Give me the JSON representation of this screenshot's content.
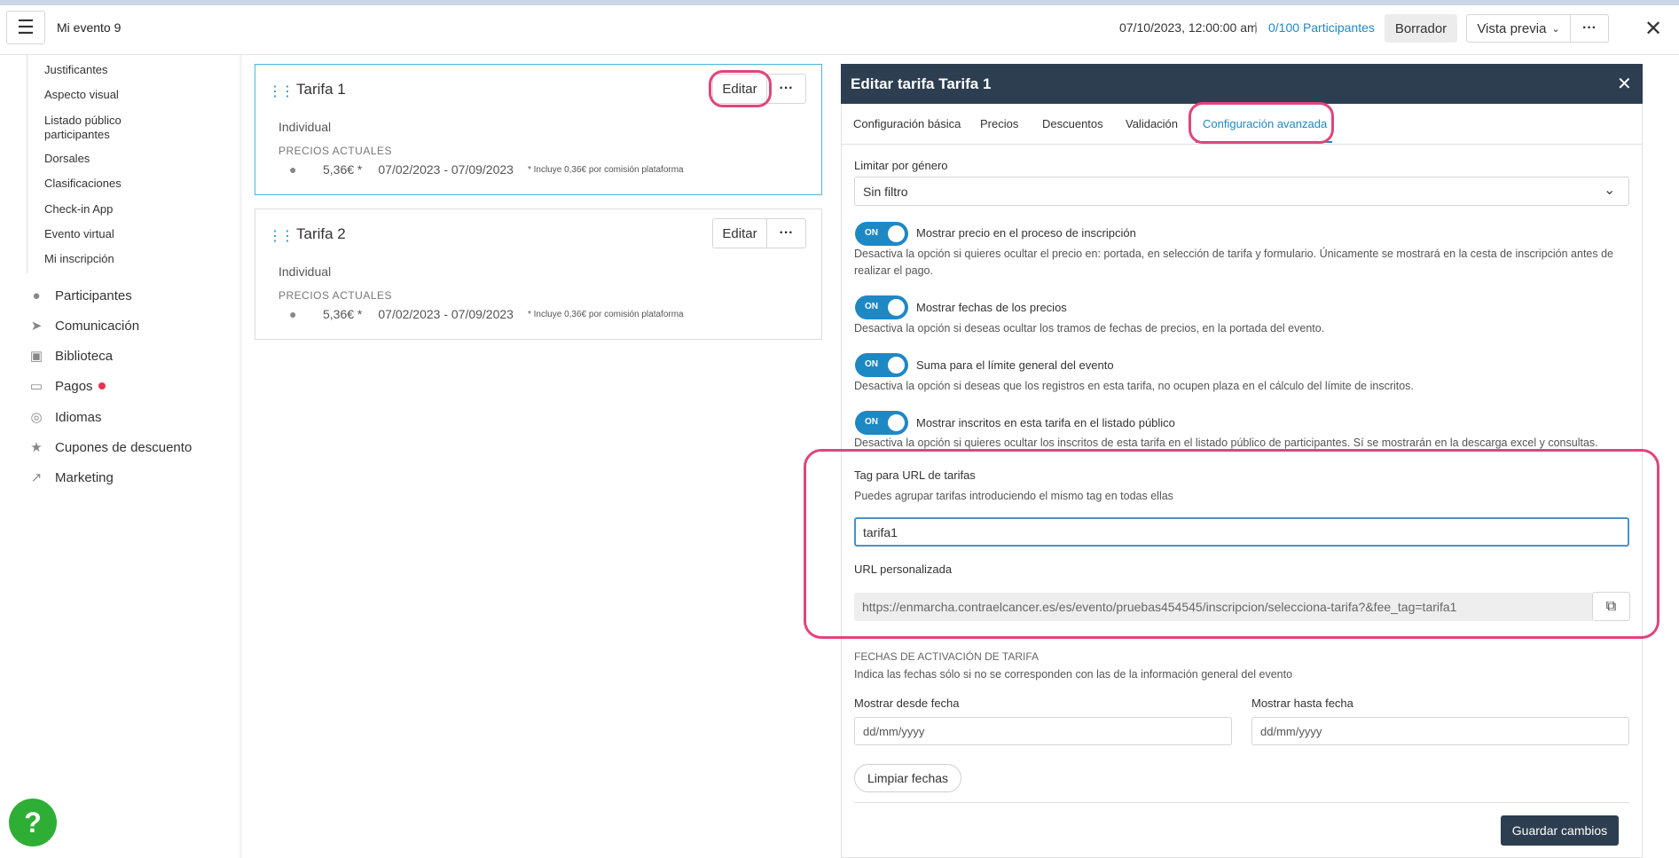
{
  "topbar": {
    "event_name": "Mi evento 9",
    "date": "07/10/2023, 12:00:00 am",
    "separator": "|",
    "participants_count": "0/100",
    "participants_label": "Participantes",
    "draft_label": "Borrador",
    "preview_label": "Vista previa"
  },
  "sidebar": {
    "subitems": [
      "Justificantes",
      "Aspecto visual",
      "Listado público participantes",
      "Dorsales",
      "Clasificaciones",
      "Check-in App",
      "Evento virtual",
      "Mi inscripción"
    ],
    "items": [
      "Participantes",
      "Comunicación",
      "Biblioteca",
      "Pagos",
      "Idiomas",
      "Cupones de descuento",
      "Marketing"
    ],
    "help": "?"
  },
  "cards": [
    {
      "title": "Tarifa 1",
      "edit_label": "Editar",
      "type": "Individual",
      "prices_label": "PRECIOS ACTUALES",
      "price": "5,36€ *",
      "dates": "07/02/2023 - 07/09/2023",
      "note": "* Incluye 0,36€ por comisión plataforma"
    },
    {
      "title": "Tarifa 2",
      "edit_label": "Editar",
      "type": "Individual",
      "prices_label": "PRECIOS ACTUALES",
      "price": "5,36€ *",
      "dates": "07/02/2023 - 07/09/2023",
      "note": "* Incluye 0,36€ por comisión plataforma"
    }
  ],
  "panel": {
    "title": "Editar tarifa Tarifa 1",
    "tabs": [
      "Configuración básica",
      "Precios",
      "Descuentos",
      "Validación",
      "Configuración avanzada"
    ],
    "active_tab": "Configuración avanzada",
    "gender_label": "Limitar por género",
    "gender_value": "Sin filtro",
    "toggles": [
      {
        "state": "ON",
        "label": "Mostrar precio en el proceso de inscripción",
        "desc": "Desactiva la opción si quieres ocultar el precio en: portada, en selección de tarifa y formulario. Únicamente se mostrará en la cesta de inscripción antes de realizar el pago."
      },
      {
        "state": "ON",
        "label": "Mostrar fechas de los precios",
        "desc": "Desactiva la opción si deseas ocultar los tramos de fechas de precios, en la portada del evento."
      },
      {
        "state": "ON",
        "label": "Suma para el límite general del evento",
        "desc": "Desactiva la opción si deseas que los registros en esta tarifa, no ocupen plaza en el cálculo del límite de inscritos."
      },
      {
        "state": "ON",
        "label": "Mostrar inscritos en esta tarifa en el listado público",
        "desc": "Desactiva la opción si quieres ocultar los inscritos de esta tarifa en el listado público de participantes. Sí se mostrarán en la descarga excel y consultas."
      }
    ],
    "tag_label": "Tag para URL de tarifas",
    "tag_desc": "Puedes agrupar tarifas introduciendo el mismo tag en todas ellas",
    "tag_value": "tarifa1",
    "url_label": "URL personalizada",
    "url_value": "https://enmarcha.contraelcancer.es/es/evento/pruebas454545/inscripcion/selecciona-tarifa?&fee_tag=tarifa1",
    "activation_label": "FECHAS DE ACTIVACIÓN DE TARIFA",
    "activation_desc": "Indica las fechas sólo si no se corresponden con las de la información general del evento",
    "from_label": "Mostrar desde fecha",
    "to_label": "Mostrar hasta fecha",
    "date_placeholder": "dd/mm/yyyy",
    "clear_label": "Limpiar fechas",
    "save_label": "Guardar cambios"
  },
  "colors": {
    "accent": "#1e88c5",
    "header": "#2c3e50",
    "highlight": "#e0457b",
    "help": "#2fae36"
  }
}
